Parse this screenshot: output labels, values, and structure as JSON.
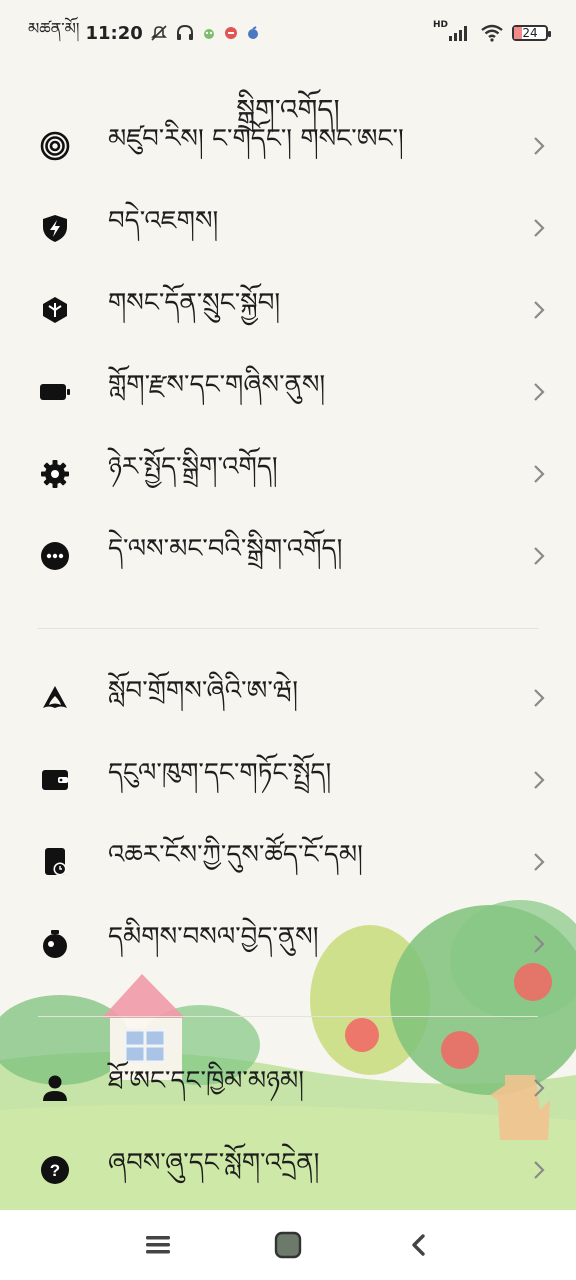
{
  "status_bar": {
    "carrier": "མཚན་མོ།",
    "time": "11:20",
    "network": "HD",
    "battery": "24",
    "battery_level": 0.24
  },
  "page_title": "སྒྲིག་འགོད།",
  "menu_group_1": [
    {
      "icon": "fingerprint-icon",
      "label": "མཛུབ་རིས། ང་གདོང་། གསང་ཨང་།"
    },
    {
      "icon": "shield-bolt-icon",
      "label": "བདེ་འཇགས།"
    },
    {
      "icon": "privacy-diamond-icon",
      "label": "གསང་དོན་སྲུང་སྐྱོབ།"
    },
    {
      "icon": "battery-icon",
      "label": "གློག་རྫས་དང་གཞིས་ནུས།"
    },
    {
      "icon": "gear-icon",
      "label": "ཉེར་སྤྱོད་སྒྲིག་འགོད།"
    },
    {
      "icon": "more-icon",
      "label": "དེ་ལས་མང་བའི་སྒྲིག་འགོད།"
    }
  ],
  "menu_group_2": [
    {
      "icon": "account-icon",
      "label": "སློབ་གྲོགས་ཞིའི་ཨ་ཝེ།"
    },
    {
      "icon": "wallet-icon",
      "label": "དངུལ་ཁུག་དང་གཏོང་སྤྲོད།"
    },
    {
      "icon": "screen-time-icon",
      "label": "འཆར་ངོས་ཀྱི་དུས་ཚོད་ངོ་དམ།"
    },
    {
      "icon": "wellbeing-timer-icon",
      "label": "དམིགས་བསལ་བྱེད་ནུས།"
    }
  ],
  "menu_group_3": [
    {
      "icon": "user-icon",
      "label": "ཐོ་ཨང་དང་ཁྱིམ་མཉམ།"
    },
    {
      "icon": "help-icon",
      "label": "ཞབས་ཞུ་དང་སློག་འདྲེན།"
    }
  ],
  "colors": {
    "background": "#f6f5ef",
    "text": "#1d1d1d",
    "chevron": "#8a8a8a",
    "navbar": "#ffffff",
    "battery_low": "#f28a8a"
  }
}
